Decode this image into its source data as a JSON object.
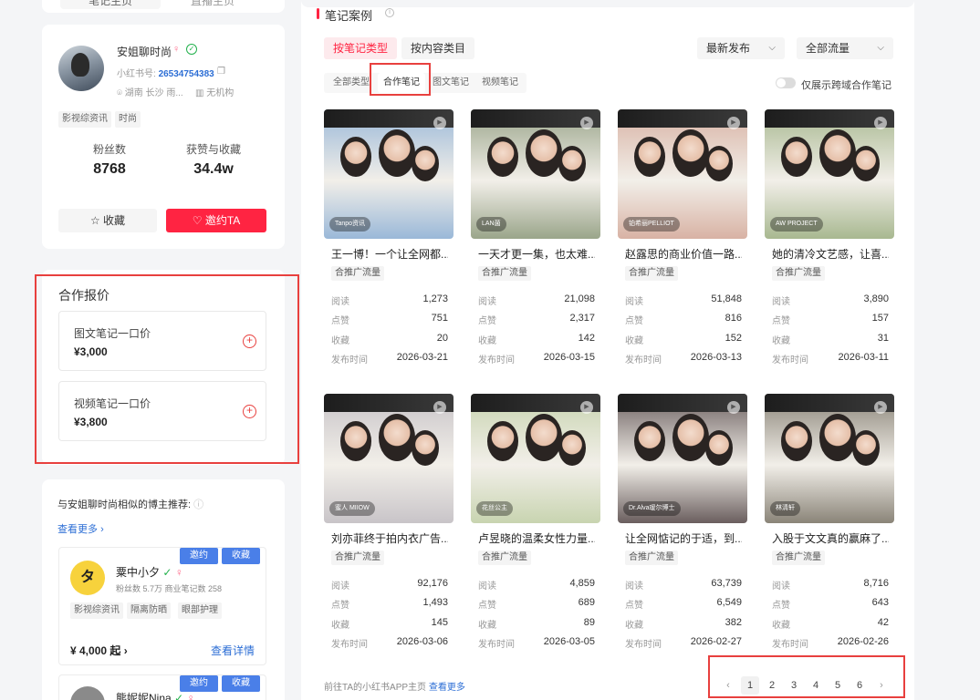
{
  "top_tabs": [
    "笔记主页",
    "直播主页"
  ],
  "profile": {
    "name": "安姐聊时尚",
    "gender_icon": "female-icon",
    "id_label": "小红书号:",
    "id_value": "26534754383",
    "location": "湖南 长沙 雨...",
    "org": "无机构",
    "tags": [
      "影视综资讯",
      "时尚"
    ],
    "fans_label": "粉丝数",
    "fans_value": "8768",
    "likes_label": "获赞与收藏",
    "likes_value": "34.4w",
    "fav_button": "收藏",
    "invite_button": "邀约TA"
  },
  "pricing": {
    "title": "合作报价",
    "items": [
      {
        "label": "图文笔记一口价",
        "price": "¥3,000"
      },
      {
        "label": "视频笔记一口价",
        "price": "¥3,800"
      }
    ]
  },
  "recommend": {
    "title": "与安姐聊时尚相似的博主推荐:",
    "see_more": "查看更多",
    "invite_label": "邀约",
    "fav_label": "收藏",
    "bloggers": [
      {
        "avatar_text": "タ",
        "name": "粟中小夕",
        "meta": "粉丝数 5.7万   商业笔记数 258",
        "tags": [
          "影视综资讯",
          "隔离防晒",
          "眼部护理"
        ],
        "price": "¥ 4,000 起",
        "detail": "查看详情"
      },
      {
        "avatar_text": "",
        "name": "熊妮妮Nina",
        "meta": "",
        "tags": [],
        "price": "",
        "detail": ""
      }
    ]
  },
  "main": {
    "section_title": "笔记案例",
    "filter_type": "按笔记类型",
    "filter_content": "按内容类目",
    "sort_select": "最新发布",
    "traffic_select": "全部流量",
    "sub_tabs": [
      "全部类型",
      "合作笔记",
      "图文笔记",
      "视频笔记"
    ],
    "active_sub_tab": 1,
    "toggle_label": "仅展示跨域合作笔记",
    "row_labels": {
      "read": "阅读",
      "like": "点赞",
      "collect": "收藏",
      "date": "发布时间"
    },
    "notes": [
      {
        "title": "王一博！一个让全网都...",
        "tag": "合推广流量",
        "read": "1,273",
        "like": "751",
        "collect": "20",
        "date": "2026-03-21",
        "author": "Tanpo资讯",
        "bg": "#9ab8d8"
      },
      {
        "title": "一天才更一集，也太难...",
        "tag": "合推广流量",
        "read": "21,098",
        "like": "2,317",
        "collect": "142",
        "date": "2026-03-15",
        "author": "LAN菌",
        "bg": "#9aa58a"
      },
      {
        "title": "赵露思的商业价值一路...",
        "tag": "合推广流量",
        "read": "51,848",
        "like": "816",
        "collect": "152",
        "date": "2026-03-13",
        "author": "铂希丽PELLIOT",
        "bg": "#d8b2a4"
      },
      {
        "title": "她的清冷文艺感，让喜...",
        "tag": "合推广流量",
        "read": "3,890",
        "like": "157",
        "collect": "31",
        "date": "2026-03-11",
        "author": "AW PROJECT",
        "bg": "#a8b890"
      },
      {
        "title": "刘亦菲终于拍内衣广告...",
        "tag": "合推广流量",
        "read": "92,176",
        "like": "1,493",
        "collect": "145",
        "date": "2026-03-06",
        "author": "蜜人 MIIOW",
        "bg": "#c8c4c8"
      },
      {
        "title": "卢昱晓的温柔女性力量...",
        "tag": "合推广流量",
        "read": "4,859",
        "like": "689",
        "collect": "89",
        "date": "2026-03-05",
        "author": "花丝公主",
        "bg": "#c8d4b0"
      },
      {
        "title": "让全网惦记的于适，到...",
        "tag": "合推广流量",
        "read": "63,739",
        "like": "6,549",
        "collect": "382",
        "date": "2026-02-27",
        "author": "Dr.Alva瑷尔博士",
        "bg": "#6a5e5e"
      },
      {
        "title": "入股于文文真的赢麻了...",
        "tag": "合推广流量",
        "read": "8,716",
        "like": "643",
        "collect": "42",
        "date": "2026-02-26",
        "author": "林清轩",
        "bg": "#8a8478"
      }
    ],
    "footer_text": "前往TA的小红书APP主页",
    "footer_link": "查看更多",
    "pages": [
      "1",
      "2",
      "3",
      "4",
      "5",
      "6"
    ],
    "active_page": "1"
  },
  "colors": {
    "brand_red": "#ff2442",
    "link_blue": "#2c6ed5",
    "highlight_frame": "#e8403e"
  }
}
